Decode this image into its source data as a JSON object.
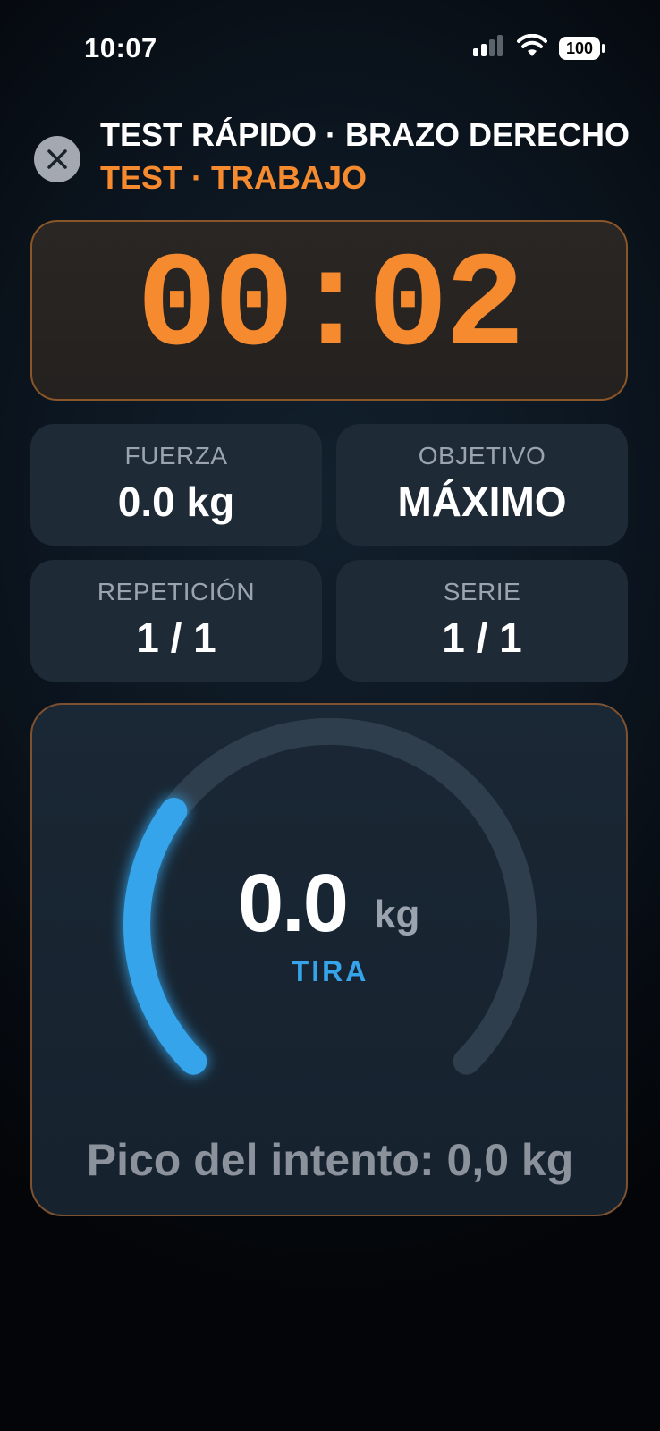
{
  "status_bar": {
    "time": "10:07",
    "battery": "100",
    "icons": [
      "signal-icon",
      "wifi-icon",
      "battery-icon"
    ]
  },
  "header": {
    "close_icon": "close-icon",
    "title": "TEST RÁPIDO · BRAZO DERECHO",
    "subtitle": "TEST · TRABAJO"
  },
  "timer": {
    "value": "00:02"
  },
  "stats": {
    "fuerza": {
      "label": "FUERZA",
      "value": "0.0 kg"
    },
    "objetivo": {
      "label": "OBJETIVO",
      "value": "MÁXIMO"
    },
    "repeticion": {
      "label": "REPETICIÓN",
      "value": "1 / 1"
    },
    "serie": {
      "label": "SERIE",
      "value": "1 / 1"
    }
  },
  "gauge": {
    "value": "0.0",
    "unit": "kg",
    "label": "TIRA",
    "fill_fraction": 0.3,
    "peak": "Pico del intento: 0,0 kg"
  },
  "colors": {
    "accent_orange": "#f68a2e",
    "accent_blue": "#36a4ea",
    "card_bg": "#1e2a36",
    "muted_text": "#9aa3ae"
  }
}
